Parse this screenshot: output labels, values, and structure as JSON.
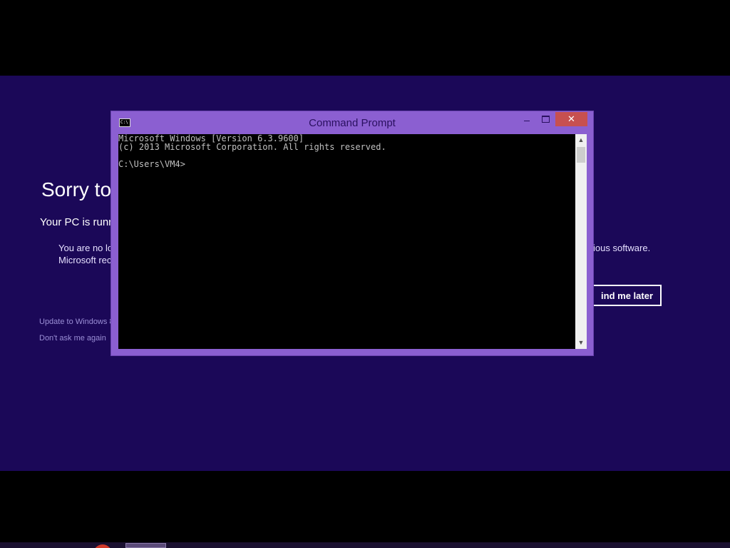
{
  "notice": {
    "title": "Sorry to",
    "subtitle": "Your PC is runni",
    "body_line_1": "You are no lo",
    "body_line_2": "Microsoft rec",
    "body_right": "ious software.",
    "remind_button": "ind me later",
    "update_link": "Update to Windows 8.",
    "dont_ask_link": "Don't ask me again"
  },
  "window": {
    "title": "Command Prompt",
    "icon_label": "C:\\",
    "minimize_icon": "minimize-icon",
    "maximize_icon": "maximize-icon",
    "close_label": "✕"
  },
  "console": {
    "lines": [
      "Microsoft Windows [Version 6.3.9600]",
      "(c) 2013 Microsoft Corporation. All rights reserved.",
      "",
      "C:\\Users\\VM4>"
    ]
  },
  "scrollbar": {
    "up_arrow": "▲",
    "down_arrow": "▼"
  },
  "colors": {
    "notice_background": "#1b0858",
    "window_frame": "#8b5fd1",
    "close_button": "#c75050",
    "console_background": "#000000",
    "console_text": "#c0c0c0"
  }
}
